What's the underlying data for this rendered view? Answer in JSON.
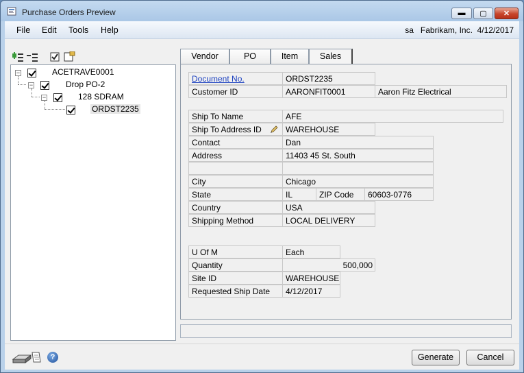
{
  "window": {
    "title": "Purchase Orders Preview"
  },
  "menu": {
    "items": [
      "File",
      "Edit",
      "Tools",
      "Help"
    ],
    "user": "sa",
    "company": "Fabrikam, Inc.",
    "date": "4/12/2017"
  },
  "tree": {
    "nodes": [
      {
        "label": "ACETRAVE0001",
        "checked": true
      },
      {
        "label": "Drop PO-2",
        "checked": true
      },
      {
        "label": "128 SDRAM",
        "checked": true
      },
      {
        "label": "ORDST2235",
        "checked": true
      }
    ]
  },
  "tabs": [
    "Vendor",
    "PO",
    "Item",
    "Sales"
  ],
  "active_tab": "Sales",
  "sales": {
    "document_no_label": "Document No.",
    "document_no": "ORDST2235",
    "customer_id_label": "Customer ID",
    "customer_id": "AARONFIT0001",
    "customer_name": "Aaron Fitz Electrical",
    "ship_to_name_label": "Ship To Name",
    "ship_to_name": "AFE",
    "ship_to_address_id_label": "Ship To Address ID",
    "ship_to_address_id": "WAREHOUSE",
    "contact_label": "Contact",
    "contact": "Dan",
    "address_label": "Address",
    "address1": "11403 45 St. South",
    "address2": "",
    "city_label": "City",
    "city": "Chicago",
    "state_label": "State",
    "state": "IL",
    "zip_label": "ZIP Code",
    "zip": "60603-0776",
    "country_label": "Country",
    "country": "USA",
    "shipping_method_label": "Shipping Method",
    "shipping_method": "LOCAL DELIVERY",
    "uofm_label": "U Of M",
    "uofm": "Each",
    "quantity_label": "Quantity",
    "quantity": "500,000",
    "site_id_label": "Site ID",
    "site_id": "WAREHOUSE",
    "requested_ship_date_label": "Requested Ship Date",
    "requested_ship_date": "4/12/2017"
  },
  "buttons": {
    "generate": "Generate",
    "cancel": "Cancel"
  },
  "colors": {
    "link": "#1a3fbf",
    "close_button": "#c7452b",
    "title_bar": "#aac7e6"
  }
}
